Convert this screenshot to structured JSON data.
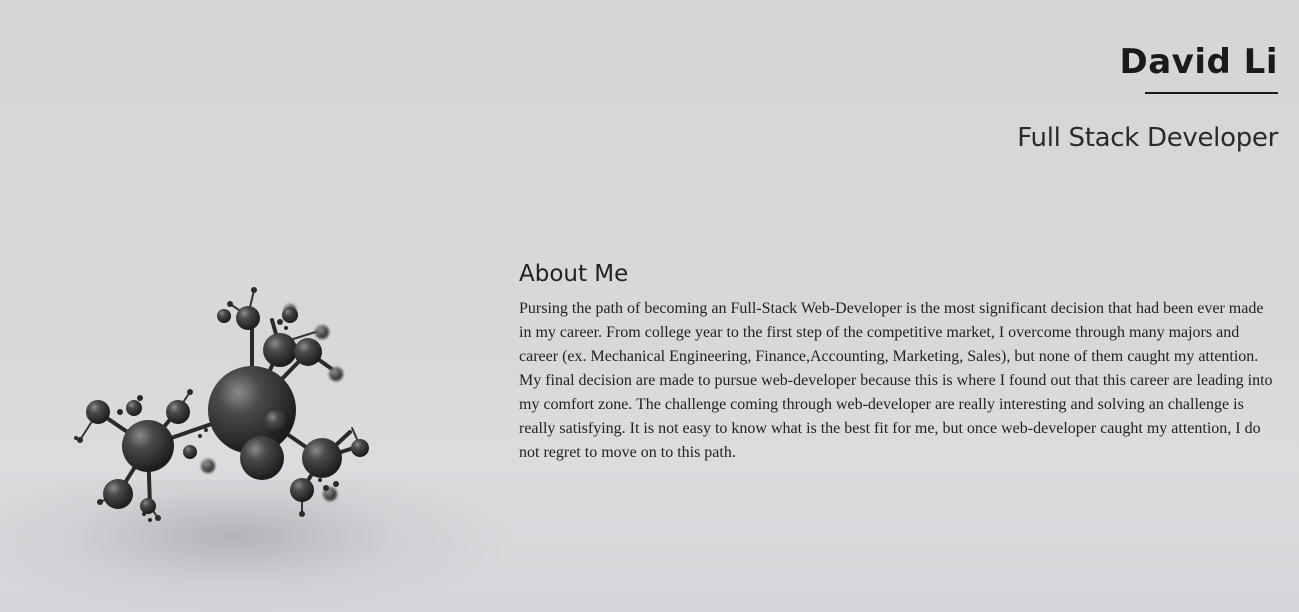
{
  "header": {
    "name": "David Li",
    "role": "Full Stack Developer"
  },
  "about": {
    "title": "About Me",
    "body": "Pursing the path of becoming an Full-Stack Web-Developer is the most significant decision that had been ever made in my career. From college year to the first step of the competitive market, I overcome through many majors and career (ex. Mechanical Engineering, Finance,Accounting, Marketing, Sales), but none of them caught my attention. My final decision are made to pursue web-developer because this is where I found out that this career are leading into my comfort zone. The challenge coming through web-developer are really interesting and solving an challenge is really satisfying. It is not easy to know what is the best fit for me, but once web-developer caught my attention, I do not regret to move on to this path."
  },
  "image": {
    "icon": "molecule-3d-render"
  },
  "colors": {
    "background": "#d6d6d6",
    "text": "#222222"
  }
}
